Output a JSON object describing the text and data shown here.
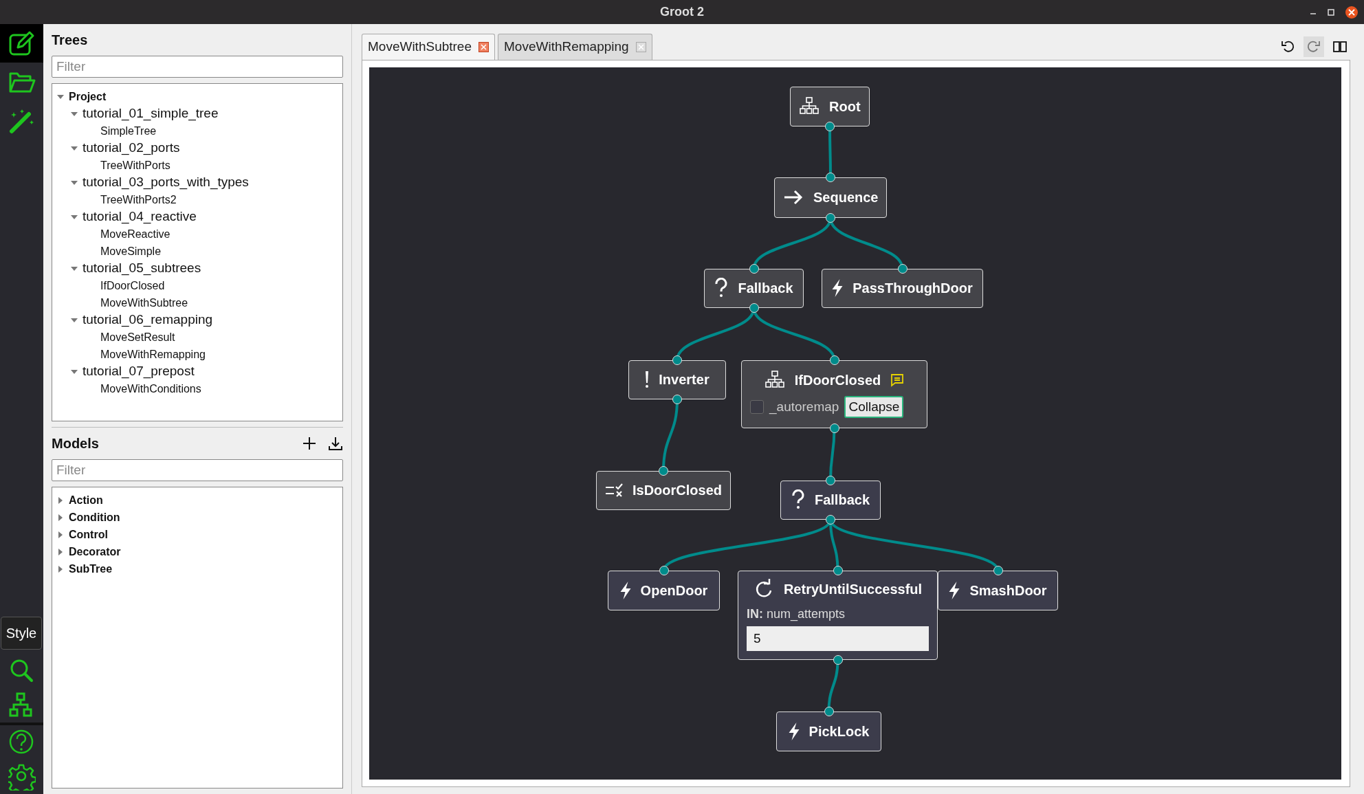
{
  "window": {
    "title": "Groot 2"
  },
  "toolbar": {
    "top": [
      {
        "kind": "edit",
        "selected": true
      },
      {
        "kind": "folder",
        "selected": false
      },
      {
        "kind": "wand",
        "selected": false
      }
    ],
    "style_button": "Style",
    "bottom": [
      {
        "kind": "search"
      },
      {
        "kind": "tree"
      },
      {
        "kind": "help"
      },
      {
        "kind": "settings"
      }
    ]
  },
  "trees": {
    "title": "Trees",
    "filter": {
      "placeholder": "Filter"
    },
    "items": [
      {
        "label": "Project",
        "expanded": true,
        "children": [
          {
            "label": "tutorial_01_simple_tree",
            "expanded": true,
            "children": [
              {
                "label": "SimpleTree"
              }
            ]
          },
          {
            "label": "tutorial_02_ports",
            "expanded": true,
            "children": [
              {
                "label": "TreeWithPorts"
              }
            ]
          },
          {
            "label": "tutorial_03_ports_with_types",
            "expanded": true,
            "children": [
              {
                "label": "TreeWithPorts2"
              }
            ]
          },
          {
            "label": "tutorial_04_reactive",
            "expanded": true,
            "children": [
              {
                "label": "MoveReactive"
              },
              {
                "label": "MoveSimple"
              }
            ]
          },
          {
            "label": "tutorial_05_subtrees",
            "expanded": true,
            "children": [
              {
                "label": "IfDoorClosed"
              },
              {
                "label": "MoveWithSubtree"
              }
            ]
          },
          {
            "label": "tutorial_06_remapping",
            "expanded": true,
            "children": [
              {
                "label": "MoveSetResult"
              },
              {
                "label": "MoveWithRemapping"
              }
            ]
          },
          {
            "label": "tutorial_07_prepost",
            "expanded": true,
            "children": [
              {
                "label": "MoveWithConditions"
              }
            ]
          }
        ]
      }
    ]
  },
  "models": {
    "title": "Models",
    "filter": {
      "placeholder": "Filter"
    },
    "items": [
      {
        "label": "Action",
        "expanded": false
      },
      {
        "label": "Condition",
        "expanded": false
      },
      {
        "label": "Control",
        "expanded": false
      },
      {
        "label": "Decorator",
        "expanded": false
      },
      {
        "label": "SubTree",
        "expanded": false
      }
    ]
  },
  "tabs": [
    {
      "label": "MoveWithSubtree",
      "selected": true
    },
    {
      "label": "MoveWithRemapping",
      "selected": false
    }
  ],
  "editor_actions": [
    {
      "kind": "undo",
      "disabled": false
    },
    {
      "kind": "redo",
      "disabled": true
    },
    {
      "kind": "split",
      "disabled": false
    }
  ],
  "graph": {
    "root": {
      "label": "Root",
      "kind": "root",
      "children": [
        {
          "label": "Sequence",
          "kind": "sequence",
          "children": [
            {
              "label": "Fallback",
              "kind": "fallback",
              "children": [
                {
                  "label": "Inverter",
                  "kind": "inverter",
                  "children": [
                    {
                      "label": "IsDoorClosed",
                      "kind": "condition"
                    }
                  ]
                },
                {
                  "label": "IfDoorClosed",
                  "kind": "subtree",
                  "comment": true,
                  "autoremap": {
                    "label": "_autoremap",
                    "checked": false
                  },
                  "button": "Collapse",
                  "children": [
                    {
                      "label": "Fallback",
                      "kind": "fallback",
                      "children": [
                        {
                          "label": "OpenDoor",
                          "kind": "action"
                        },
                        {
                          "label": "RetryUntilSuccessful",
                          "kind": "retry",
                          "port": {
                            "label": "**IN:** num_attempts",
                            "value": "5"
                          },
                          "children": [
                            {
                              "label": "PickLock",
                              "kind": "action"
                            }
                          ]
                        },
                        {
                          "label": "SmashDoor",
                          "kind": "action"
                        }
                      ]
                    }
                  ]
                }
              ]
            },
            {
              "label": "PassThroughDoor",
              "kind": "action"
            }
          ]
        }
      ]
    }
  }
}
